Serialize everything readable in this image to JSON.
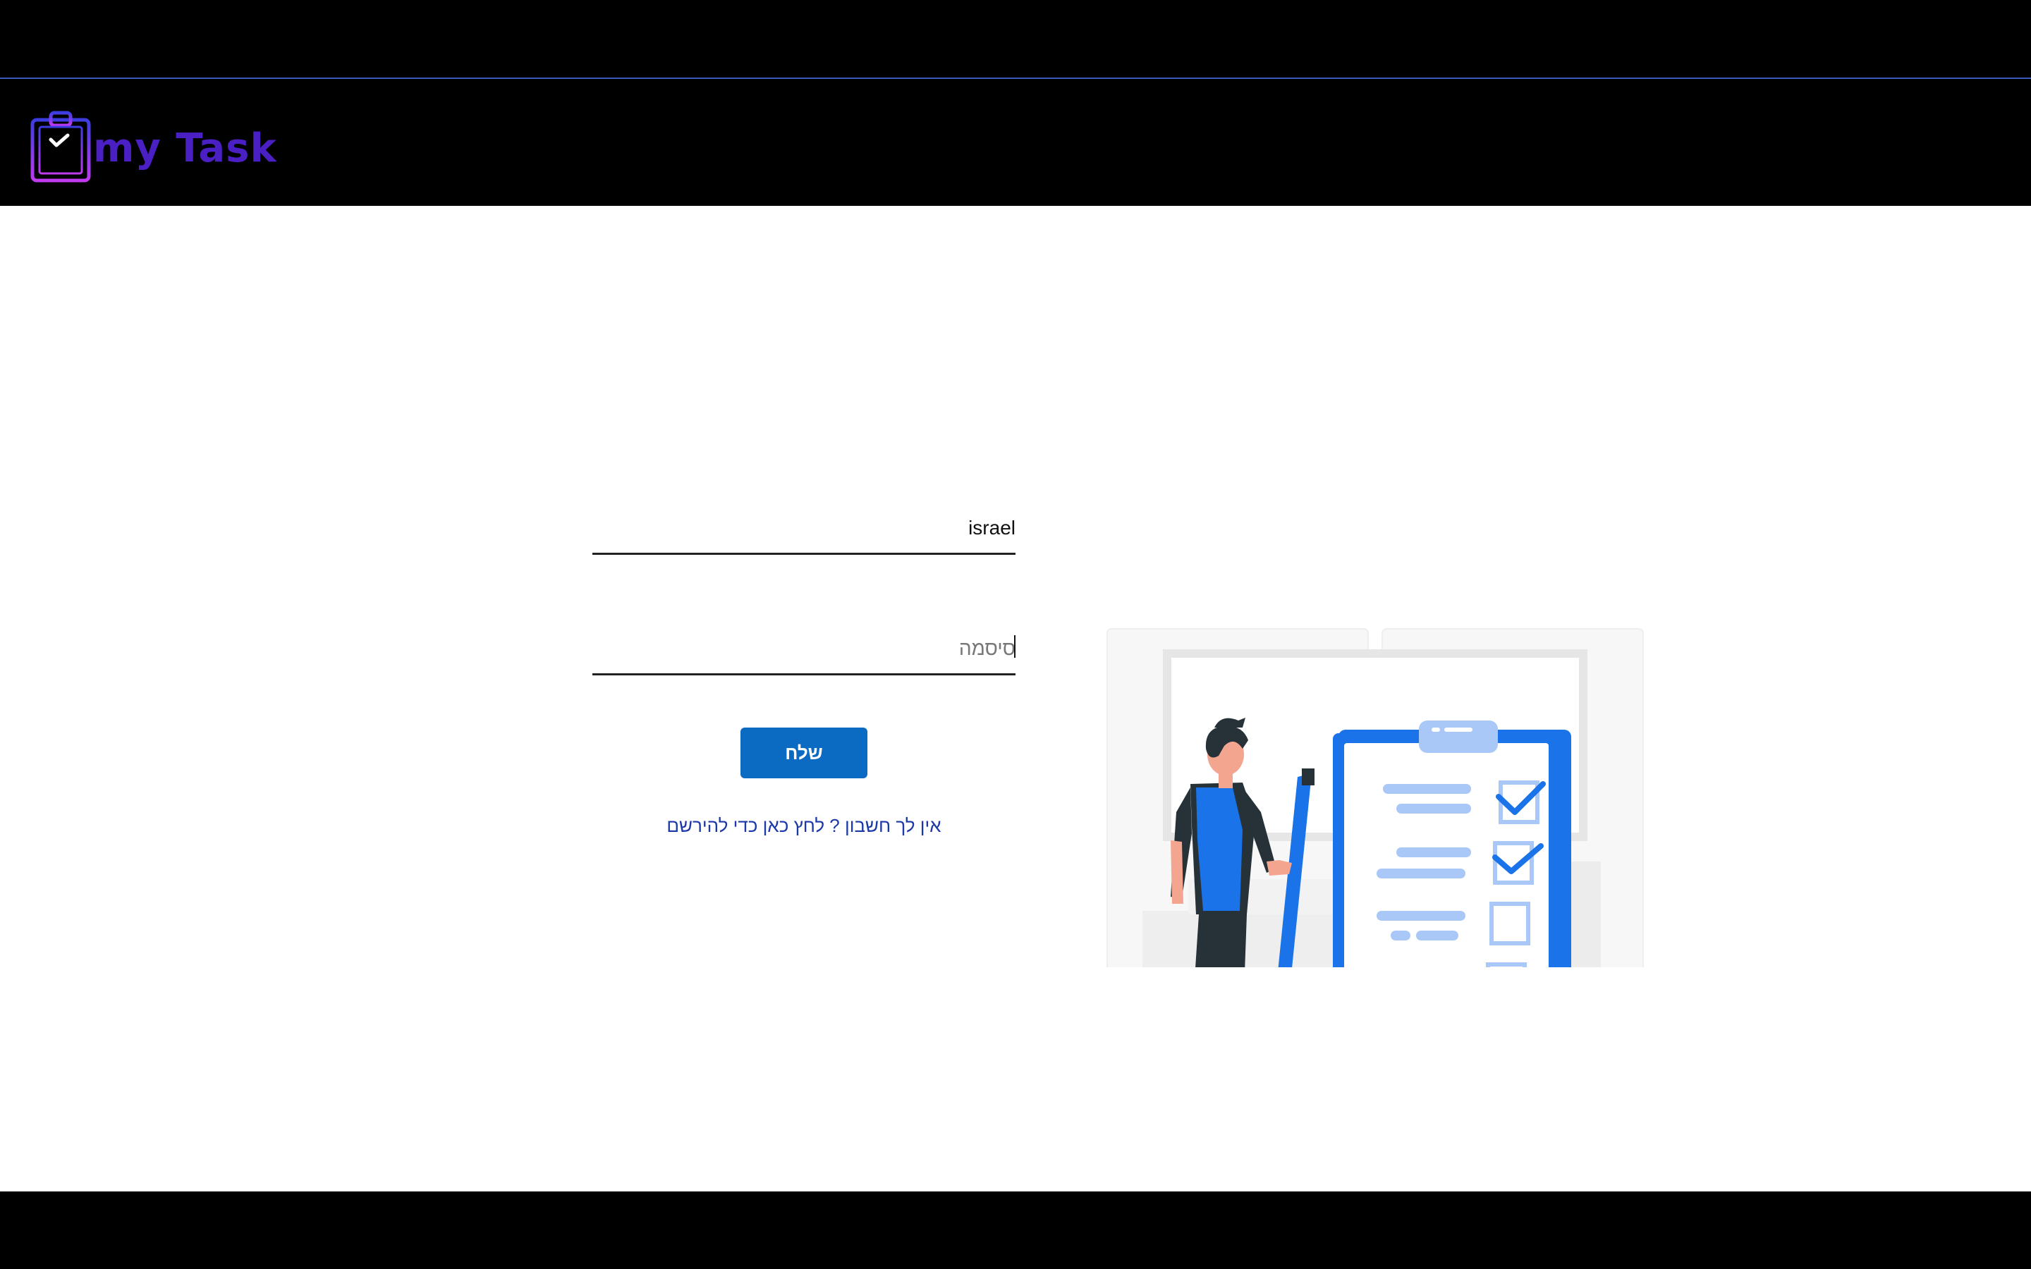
{
  "brand": {
    "name": "my Task",
    "logo_icon": "clipboard-check-icon",
    "logo_color": "#b23cf0",
    "name_color": "#4a1fc4"
  },
  "login": {
    "username_value": "israel",
    "username_placeholder": "",
    "password_value": "",
    "password_placeholder": "סיסמה",
    "submit_label": "שלח",
    "register_link": "אין לך חשבון ? לחץ כאן כדי להירשם"
  },
  "illustration": {
    "icon": "person-with-checklist-illustration",
    "accent_color": "#1a73e8"
  },
  "colors": {
    "header_bg": "#000000",
    "header_border": "#3a5bb8",
    "button_bg": "#0b6bc2",
    "link": "#1b3aa8"
  }
}
